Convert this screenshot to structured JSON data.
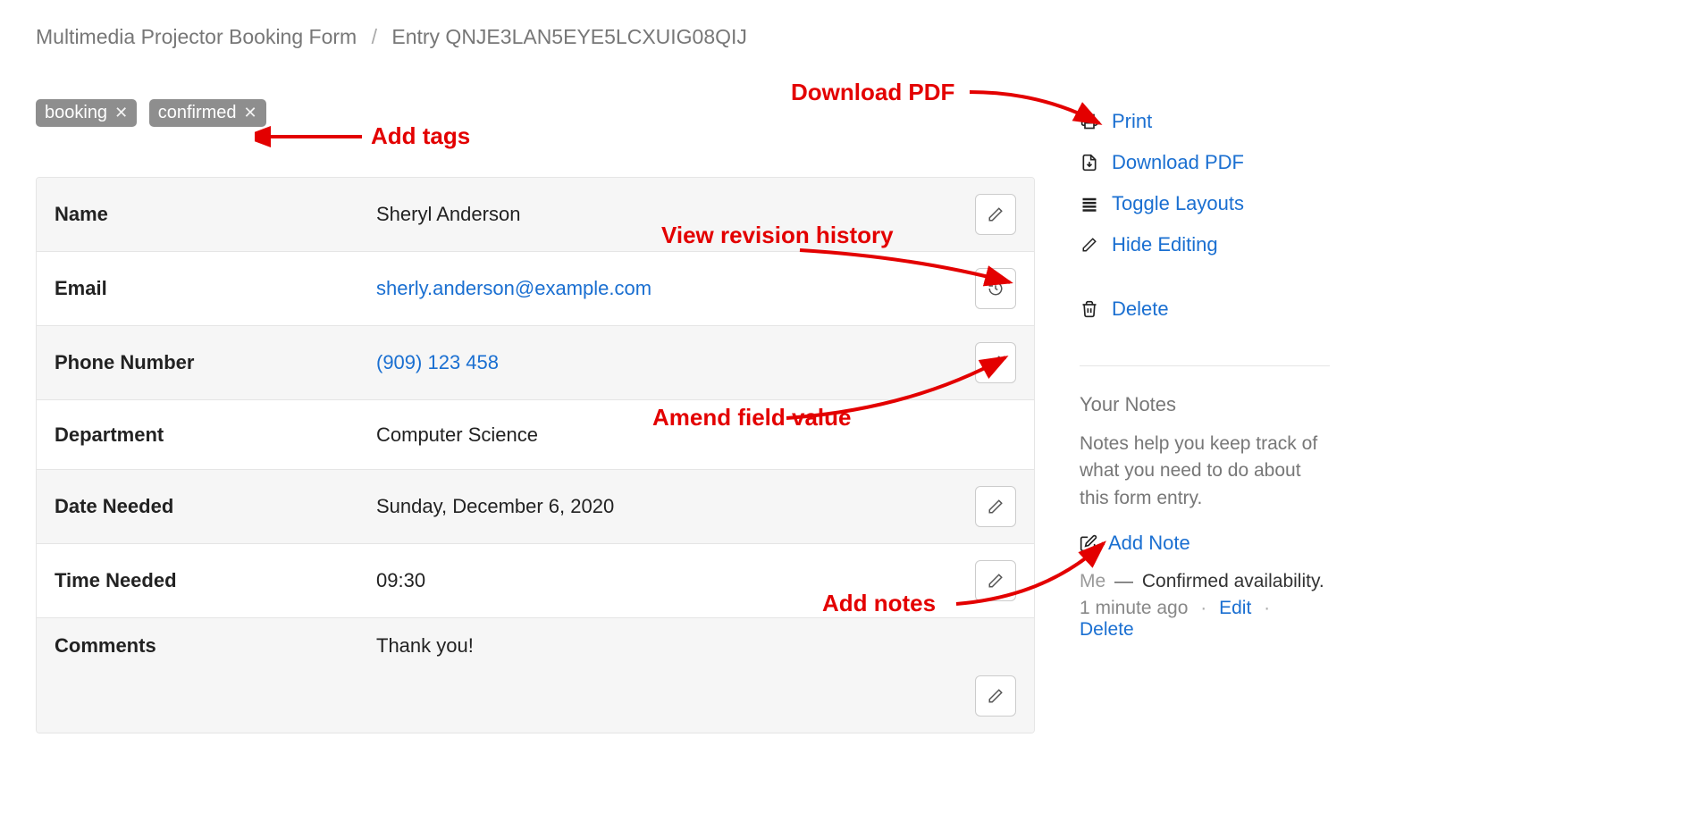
{
  "breadcrumb": {
    "parent": "Multimedia Projector Booking Form",
    "current": "Entry QNJE3LAN5EYE5LCXUIG08QIJ"
  },
  "tags": [
    "booking",
    "confirmed"
  ],
  "fields": [
    {
      "label": "Name",
      "value": "Sheryl Anderson",
      "link": false,
      "action": "edit"
    },
    {
      "label": "Email",
      "value": "sherly.anderson@example.com",
      "link": true,
      "action": "history"
    },
    {
      "label": "Phone Number",
      "value": "(909) 123 458",
      "link": true,
      "action": "edit"
    },
    {
      "label": "Department",
      "value": "Computer Science",
      "link": false,
      "action": "none"
    },
    {
      "label": "Date Needed",
      "value": "Sunday, December 6, 2020",
      "link": false,
      "action": "edit"
    },
    {
      "label": "Time Needed",
      "value": "09:30",
      "link": false,
      "action": "edit"
    },
    {
      "label": "Comments",
      "value": "Thank you!",
      "link": false,
      "action": "edit-below"
    }
  ],
  "sidebar": {
    "actions": {
      "print": "Print",
      "download_pdf": "Download PDF",
      "toggle_layouts": "Toggle Layouts",
      "hide_editing": "Hide Editing",
      "delete": "Delete"
    },
    "notes": {
      "title": "Your Notes",
      "help": "Notes help you keep track of what you need to do about this form entry.",
      "add_label": "Add Note",
      "entry": {
        "author": "Me",
        "text": "Confirmed availability.",
        "time": "1 minute ago",
        "edit_label": "Edit",
        "delete_label": "Delete"
      }
    }
  },
  "annotations": {
    "add_tags": "Add tags",
    "download_pdf": "Download PDF",
    "revision_history": "View revision history",
    "amend_field": "Amend field value",
    "add_notes": "Add notes"
  }
}
